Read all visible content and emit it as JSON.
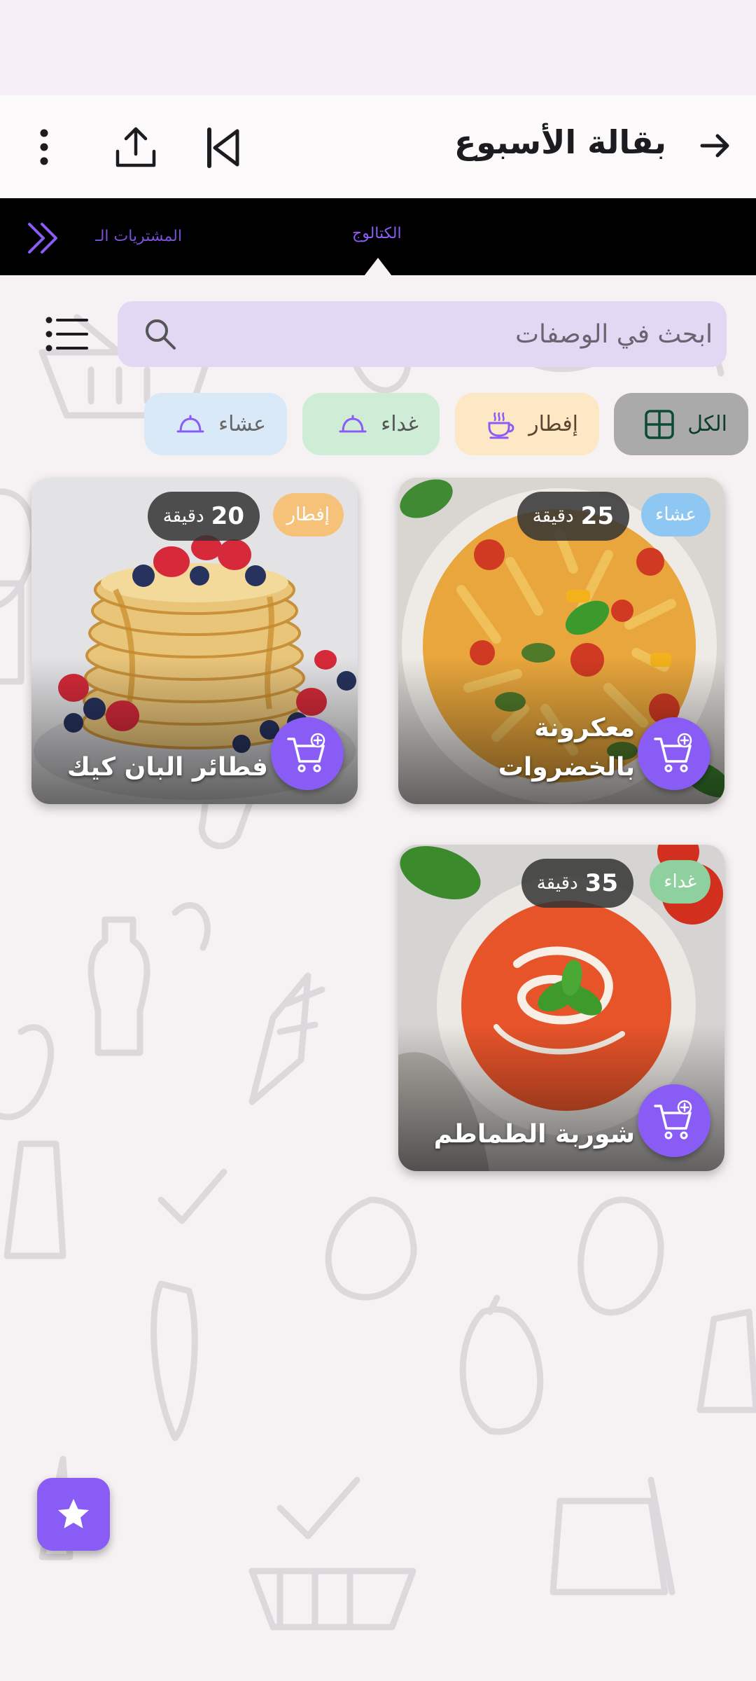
{
  "app_bar": {
    "title": "بقالة الأسبوع",
    "back_icon": "arrow-right-icon",
    "first_icon": "skip-first-icon",
    "share_icon": "share-icon",
    "menu_icon": "more-vert-icon"
  },
  "tabs": {
    "catalog": "الكتالوج",
    "purchases": "المشتريات الـ",
    "active": "catalog"
  },
  "search": {
    "placeholder": "ابحث في الوصفات"
  },
  "filters": [
    {
      "label": "الكل",
      "icon": "grid-icon",
      "selected": true
    },
    {
      "label": "إفطار",
      "icon": "coffee-cup-icon"
    },
    {
      "label": "غداء",
      "icon": "cloche-icon"
    },
    {
      "label": "عشاء",
      "icon": "cloche-icon"
    }
  ],
  "recipes": [
    {
      "title": "معكرونة بالخضروات",
      "category": "عشاء",
      "minutes": "25",
      "unit": "دقيقة"
    },
    {
      "title": "فطائر البان كيك",
      "category": "إفطار",
      "minutes": "20",
      "unit": "دقيقة"
    },
    {
      "title": "شوربة الطماطم",
      "category": "غداء",
      "minutes": "35",
      "unit": "دقيقة"
    }
  ],
  "colors": {
    "accent": "#8a5cf6",
    "dinner_badge": "#8ec8f2",
    "breakfast_badge": "#f6c27a",
    "lunch_badge": "#8fd19e"
  },
  "fab_icon": "star-icon"
}
